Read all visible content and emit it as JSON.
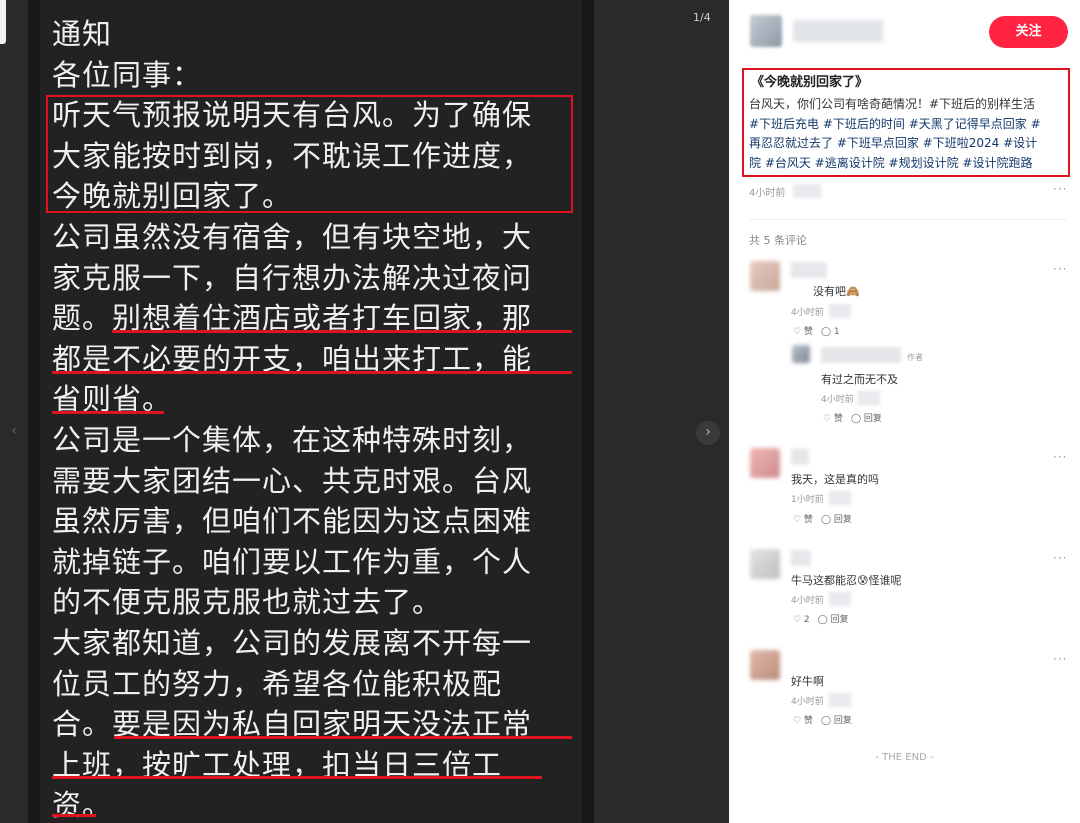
{
  "viewer": {
    "page_indicator": "1/4",
    "prev_icon": "‹",
    "next_icon": "›",
    "note_lines": [
      "通知",
      "各位同事：",
      "听天气预报说明天有台风。为了确保",
      "大家能按时到岗，不耽误工作进度，",
      "今晚就别回家了。",
      "公司虽然没有宿舍，但有块空地，大",
      "家克服一下，自行想办法解决过夜问",
      "题。别想着住酒店或者打车回家，那",
      "都是不必要的开支，咱出来打工，能",
      "省则省。",
      "公司是一个集体，在这种特殊时刻，",
      "需要大家团结一心、共克时艰。台风",
      "虽然厉害，但咱们不能因为这点困难",
      "就掉链子。咱们要以工作为重，个人",
      "的不便克服克服也就过去了。",
      "大家都知道，公司的发展离不开每一",
      "位员工的努力，希望各位能积极配",
      "合。要是因为私自回家明天没法正常",
      "上班，按旷工处理，扣当日三倍工",
      "资。"
    ]
  },
  "panel": {
    "follow_label": "关注",
    "post_title": "《今晚就别回家了》",
    "post_body_lines": [
      "台风天，你们公司有啥奇葩情况！#下班后的别样生活",
      "#下班后充电 #下班后的时间 #天黑了记得早点回家 #",
      "再忍忍就过去了 #下班早点回家 #下班啦2024 #设计",
      "院 #台风天 #逃离设计院 #规划设计院 #设计院跑路"
    ],
    "post_time": "4小时前",
    "more_icon": "···",
    "comments_count_label": "共 5 条评论",
    "comments": [
      {
        "text": "没有吧🙈",
        "time": "4小时前",
        "like": "♡ 赞",
        "reply": "◯ 1"
      },
      {
        "text": "有过之而无不及",
        "time": "4小时前",
        "like": "♡ 赞",
        "reply": "◯ 回复",
        "author_tag": "作者"
      },
      {
        "text": "我天，这是真的吗",
        "time": "1小时前",
        "like": "♡ 赞",
        "reply": "◯ 回复"
      },
      {
        "text": "牛马这都能忍😰怪谁呢",
        "time": "4小时前",
        "like": "♡ 2",
        "reply": "◯ 回复"
      },
      {
        "text": "好牛啊",
        "time": "4小时前",
        "like": "♡ 赞",
        "reply": "◯ 回复"
      }
    ],
    "the_end": "- THE END -"
  }
}
